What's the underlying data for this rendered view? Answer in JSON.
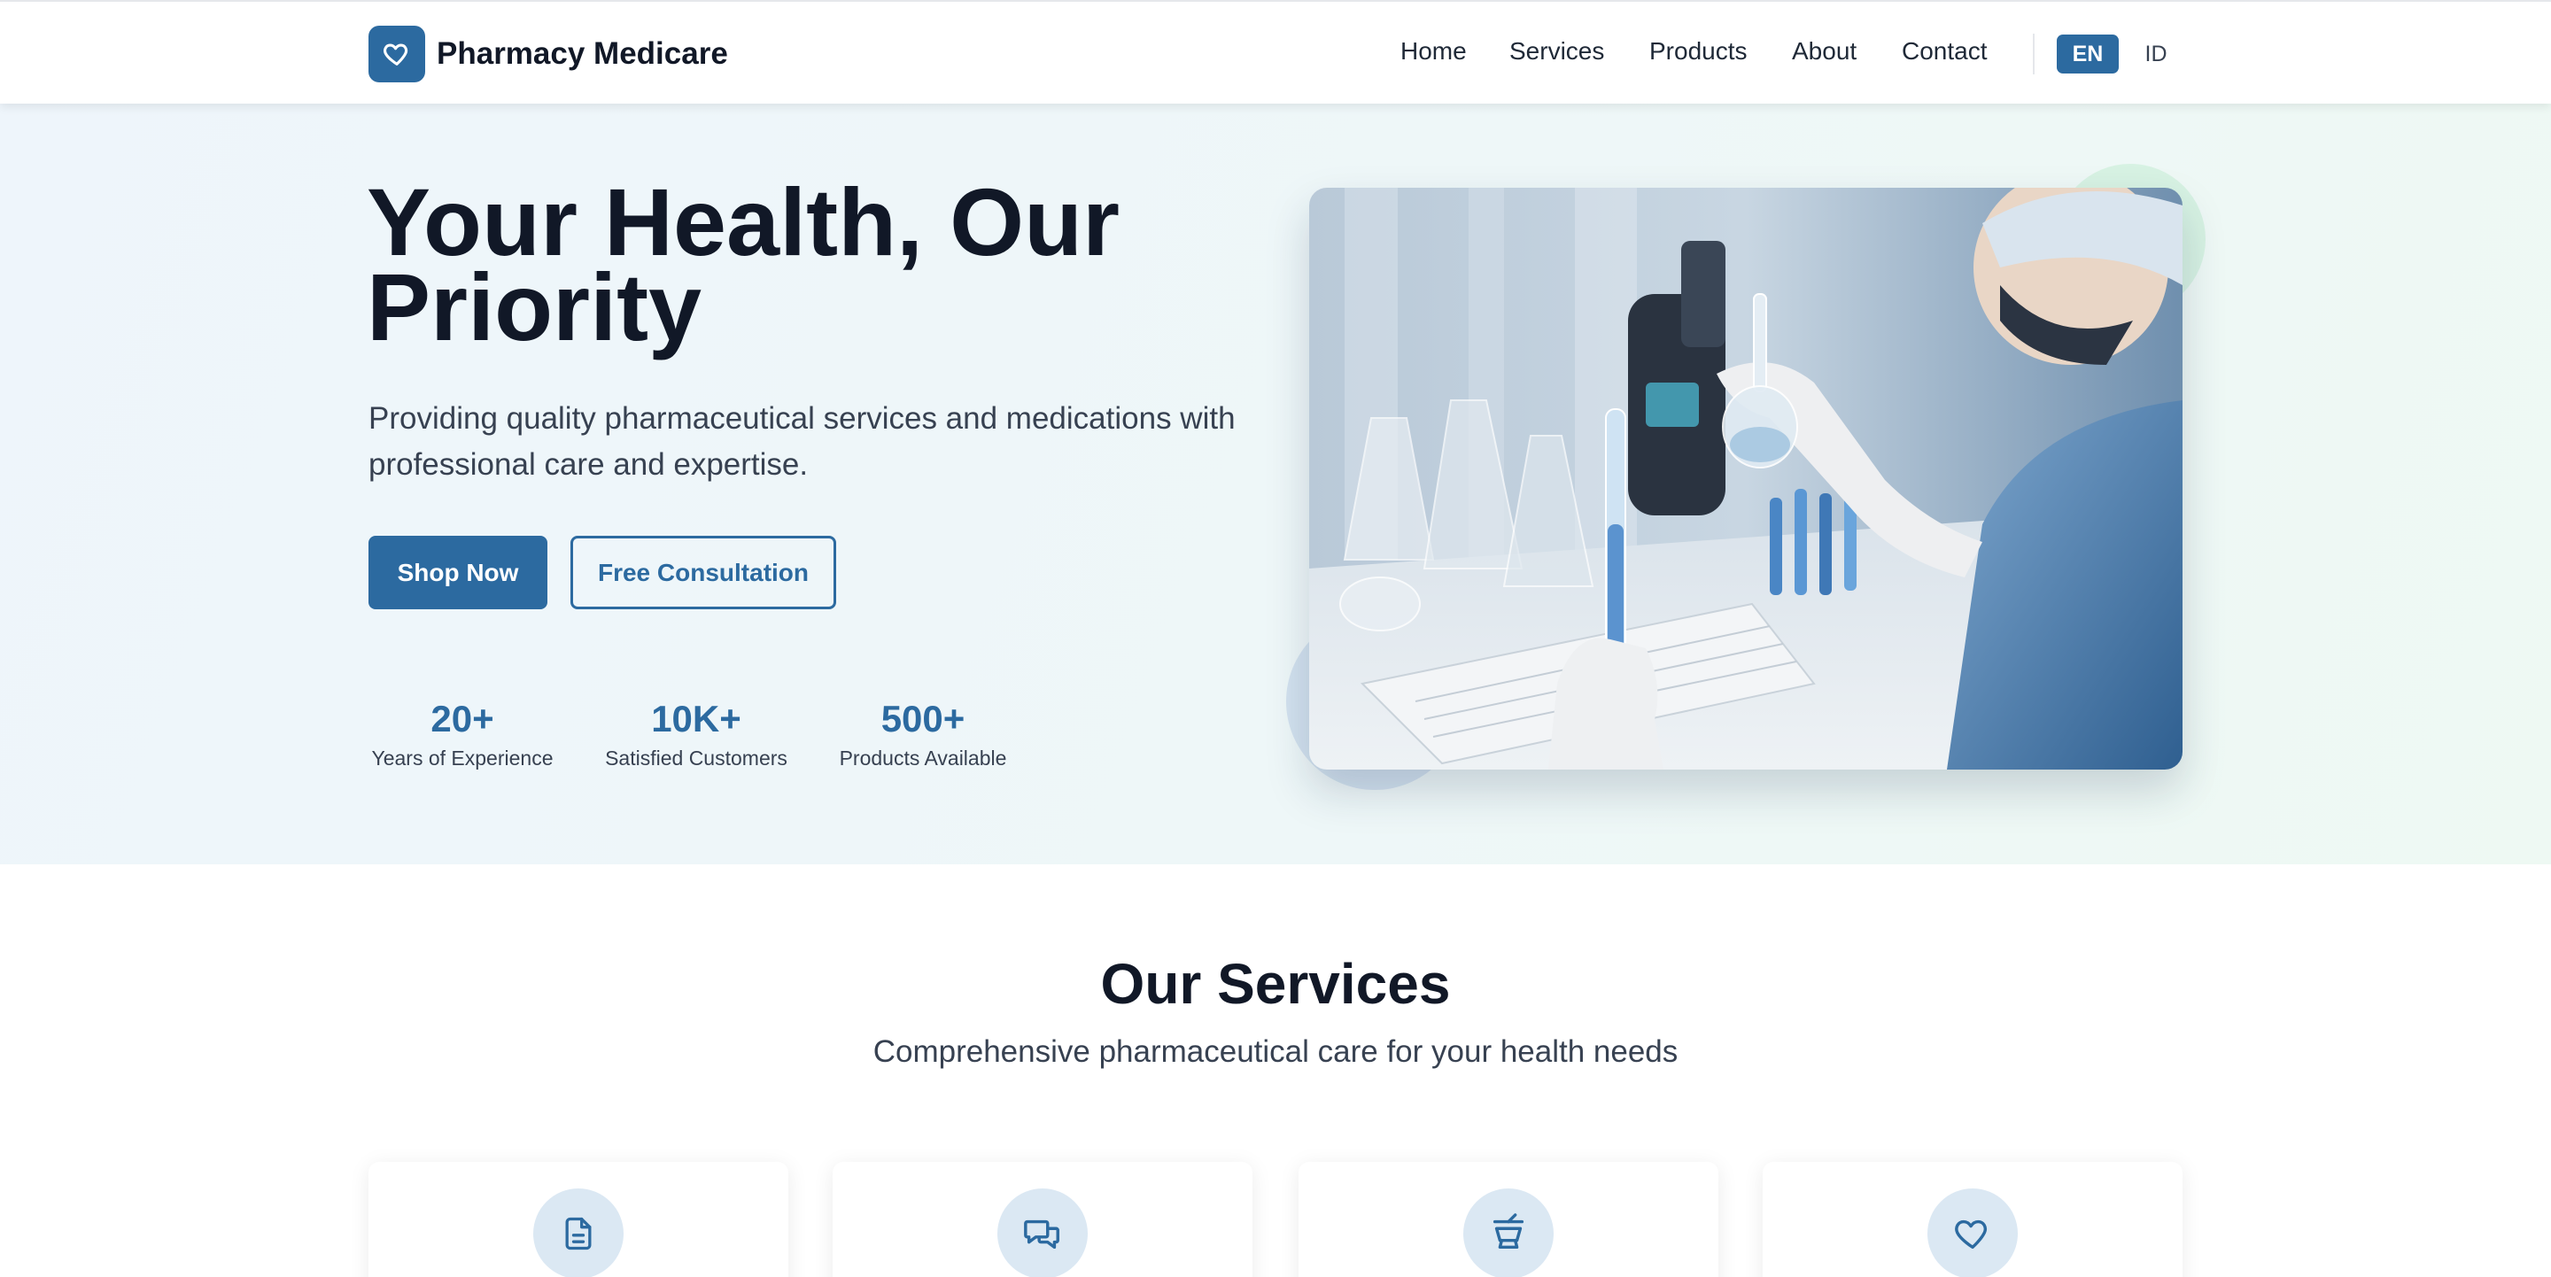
{
  "header": {
    "brand_name": "Pharmacy Medicare",
    "nav": [
      "Home",
      "Services",
      "Products",
      "About",
      "Contact"
    ],
    "languages": {
      "active": "EN",
      "other": "ID"
    }
  },
  "hero": {
    "title": "Your Health, Our Priority",
    "subtitle": "Providing quality pharmaceutical services and medications with professional care and expertise.",
    "primary_button": "Shop Now",
    "secondary_button": "Free Consultation",
    "stats": [
      {
        "value": "20+",
        "label": "Years of Experience"
      },
      {
        "value": "10K+",
        "label": "Satisfied Customers"
      },
      {
        "value": "500+",
        "label": "Products Available"
      }
    ],
    "image_icon": "lab-scientist-photo"
  },
  "services": {
    "title": "Our Services",
    "subtitle": "Comprehensive pharmaceutical care for your health needs",
    "cards": [
      {
        "icon": "document-icon"
      },
      {
        "icon": "chat-icon"
      },
      {
        "icon": "mortar-pestle-icon"
      },
      {
        "icon": "heart-icon"
      }
    ]
  },
  "colors": {
    "primary": "#2c6aa0",
    "icon_bg": "#dbe8f3",
    "deco_green": "#d7f2e3",
    "text_dark": "#111827"
  }
}
